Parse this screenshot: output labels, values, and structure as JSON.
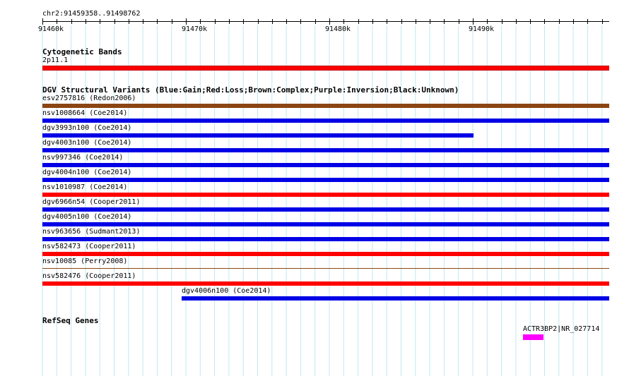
{
  "region": {
    "coordinate_label": "chr2:91459358..91498762",
    "ticks": [
      "91460k",
      "91470k",
      "91480k",
      "91490k"
    ]
  },
  "colors": {
    "gain": "#0000e6",
    "loss": "#ff0000",
    "complex": "#8b4513",
    "gene": "#ff00ff",
    "gridline": "#bfe8f0"
  },
  "tracks": {
    "cytoband": {
      "title": "Cytogenetic Bands",
      "band_label": "2p11.1",
      "color": "#ff0000"
    },
    "dgv": {
      "title": "DGV Structural Variants (Blue:Gain;Red:Loss;Brown:Complex;Purple:Inversion;Black:Unknown)",
      "variants": [
        {
          "label": "esv2757816 (Redon2006)",
          "type": "complex"
        },
        {
          "label": "nsv1008664 (Coe2014)",
          "type": "gain"
        },
        {
          "label": "dgv3993n100 (Coe2014)",
          "type": "gain"
        },
        {
          "label": "dgv4003n100 (Coe2014)",
          "type": "gain"
        },
        {
          "label": "nsv997346 (Coe2014)",
          "type": "gain"
        },
        {
          "label": "dgv4004n100 (Coe2014)",
          "type": "gain"
        },
        {
          "label": "nsv1010987 (Coe2014)",
          "type": "loss"
        },
        {
          "label": "dgv6966n54 (Cooper2011)",
          "type": "gain"
        },
        {
          "label": "dgv4005n100 (Coe2014)",
          "type": "gain"
        },
        {
          "label": "nsv963656 (Sudmant2013)",
          "type": "gain"
        },
        {
          "label": "nsv582473 (Cooper2011)",
          "type": "loss"
        },
        {
          "label": "nsv10085 (Perry2008)",
          "type": "complex"
        },
        {
          "label": "nsv582476 (Cooper2011)",
          "type": "loss"
        },
        {
          "label": "dgv4006n100 (Coe2014)",
          "type": "gain"
        }
      ]
    },
    "refseq": {
      "title": "RefSeq Genes",
      "gene_label": "ACTR3BP2|NR_027714"
    }
  }
}
